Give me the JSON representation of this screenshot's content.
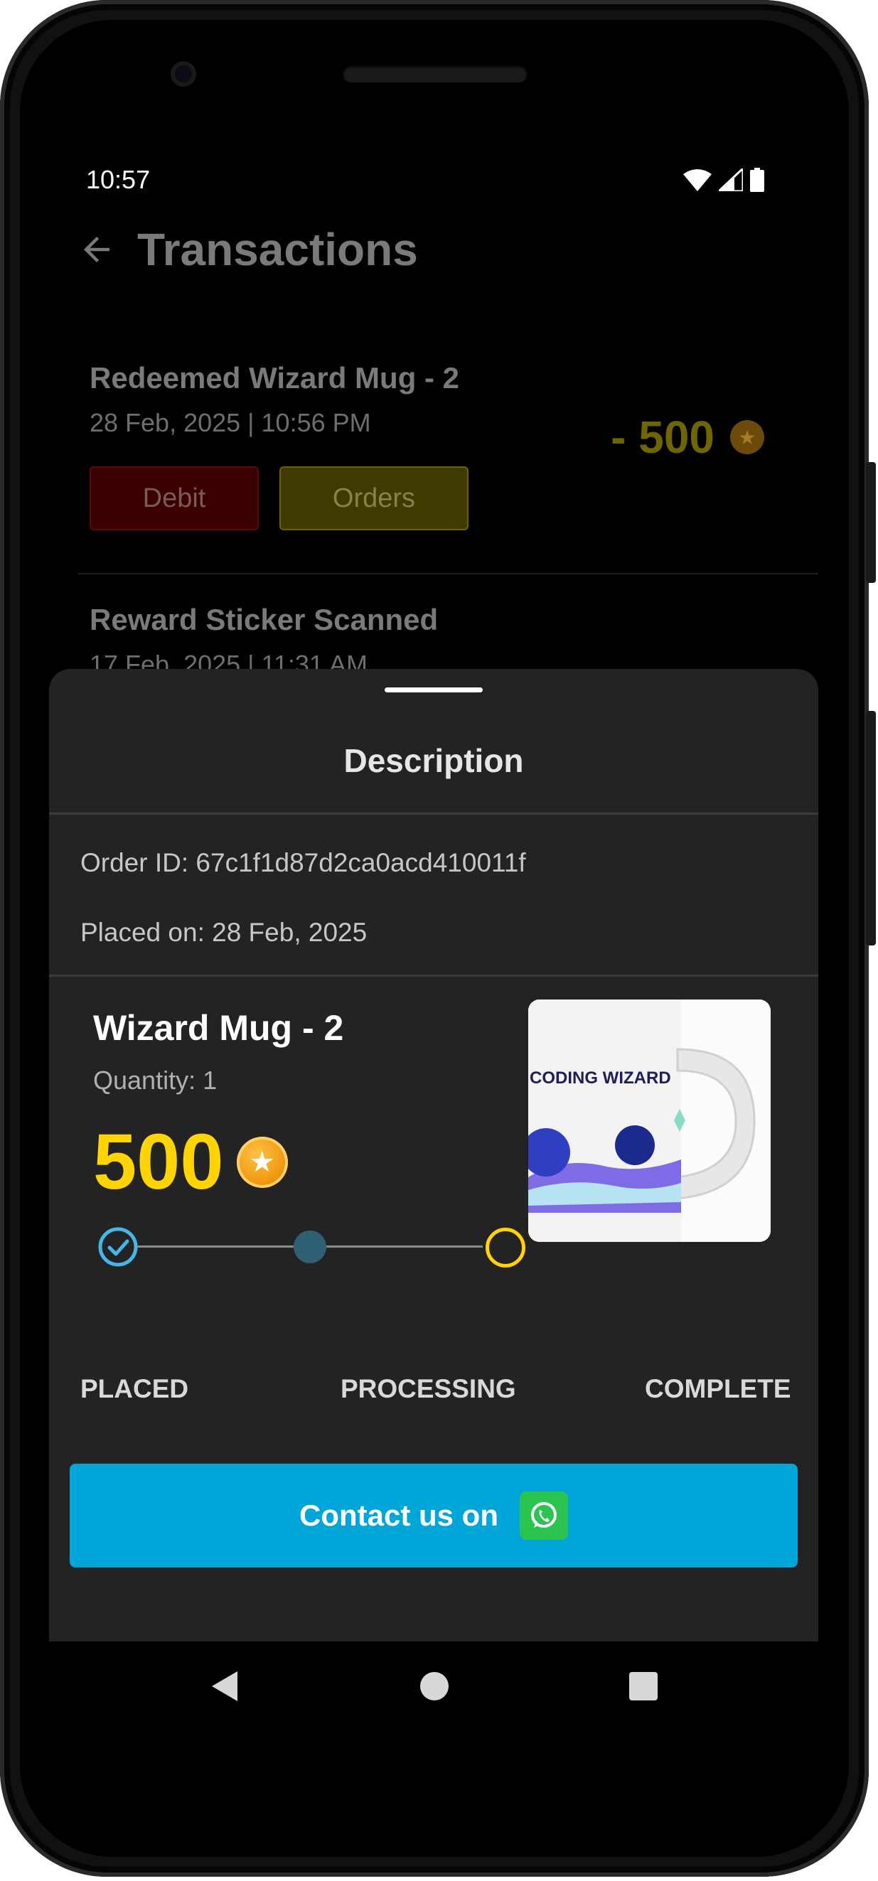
{
  "status_bar": {
    "time": "10:57"
  },
  "appbar": {
    "title": "Transactions"
  },
  "transactions": [
    {
      "name": "Redeemed Wizard Mug - 2",
      "date": "28 Feb, 2025 | 10:56 PM",
      "amount": "- 500",
      "tags": [
        "Debit",
        "Orders"
      ]
    },
    {
      "name": "Reward Sticker Scanned",
      "date": "17 Feb, 2025 | 11:31 AM"
    }
  ],
  "sheet": {
    "title": "Description",
    "order_id": "Order ID: 67c1f1d87d2ca0acd410011f",
    "placed_on": "Placed on: 28 Feb, 2025",
    "product": {
      "name": "Wizard Mug - 2",
      "quantity": "Quantity: 1",
      "price": "500",
      "image_text": "CODING WIZARD"
    },
    "steps": [
      "PLACED",
      "PROCESSING",
      "COMPLETE"
    ],
    "progress_step": 1,
    "contact_label": "Contact us on"
  },
  "icons": {
    "back": "arrow-left-icon",
    "coin": "star-coin-icon",
    "whatsapp": "whatsapp-icon",
    "nav": [
      "back-triangle-icon",
      "home-circle-icon",
      "recents-square-icon"
    ]
  },
  "colors": {
    "accent": "#00a6d8",
    "price": "#ffd400",
    "placed": "#46b6e8",
    "processing": "#2f5f72",
    "complete": "#ffd400",
    "debit": "#ff3b3b",
    "orders": "#e6c200"
  }
}
